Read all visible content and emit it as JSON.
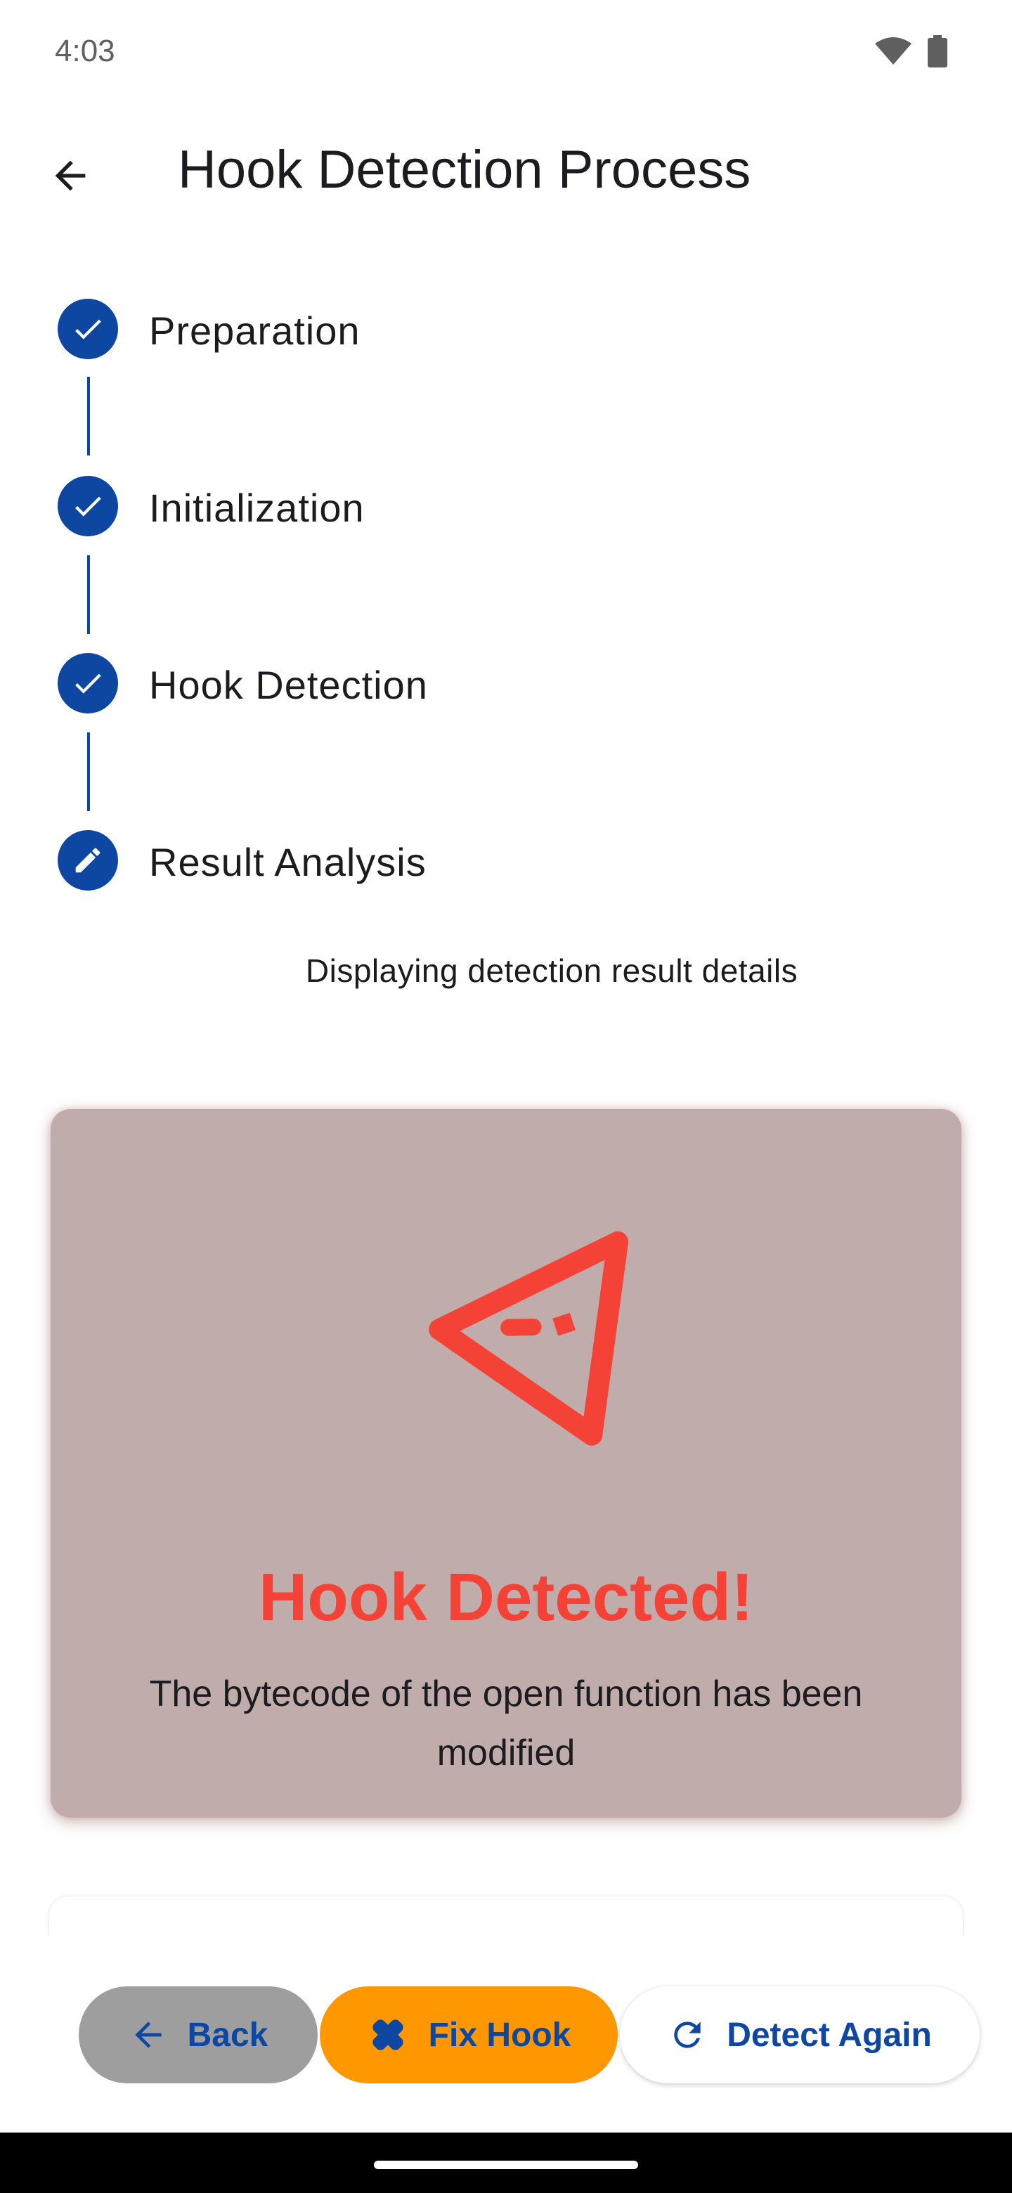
{
  "status_bar": {
    "time": "4:03",
    "icons": [
      "wifi-icon",
      "battery-icon"
    ]
  },
  "app_bar": {
    "title": "Hook Detection Process",
    "back_icon": "arrow-back-icon"
  },
  "stepper": {
    "steps": [
      {
        "label": "Preparation",
        "state": "completed",
        "icon": "check-icon"
      },
      {
        "label": "Initialization",
        "state": "completed",
        "icon": "check-icon"
      },
      {
        "label": "Hook Detection",
        "state": "completed",
        "icon": "check-icon"
      },
      {
        "label": "Result Analysis",
        "state": "editing",
        "icon": "edit-pencil-icon"
      }
    ],
    "active_step_detail": "Displaying detection result details"
  },
  "result_card": {
    "icon": "warning-triangle-icon",
    "title": "Hook Detected!",
    "description": "The bytecode of the open function has been modified"
  },
  "actions": {
    "back": {
      "label": "Back",
      "icon": "arrow-back-icon"
    },
    "fix": {
      "label": "Fix Hook",
      "icon": "healing-bandage-icon"
    },
    "detect_again": {
      "label": "Detect Again",
      "icon": "refresh-icon"
    }
  },
  "colors": {
    "primary": "#0d47a1",
    "danger": "#f44336",
    "accent": "#ff9800",
    "card_bg": "#c0adab",
    "neutral_button": "#9e9e9e"
  }
}
